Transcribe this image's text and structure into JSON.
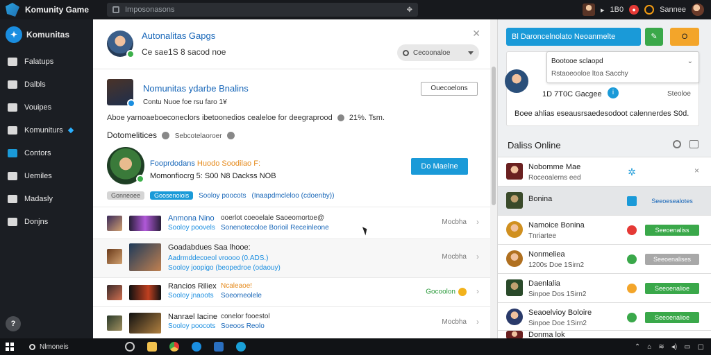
{
  "app": {
    "title": "Komunity Game"
  },
  "search": {
    "placeholder": "Imposonasons"
  },
  "topbar": {
    "counter": "1B0",
    "user": "Sannee"
  },
  "sidebar": {
    "brand": "Komunitas",
    "items": [
      {
        "label": "Falatups"
      },
      {
        "label": "Dalbls"
      },
      {
        "label": "Vouipes"
      },
      {
        "label": "Komuniturs"
      },
      {
        "label": "Contors"
      },
      {
        "label": "Uemiles"
      },
      {
        "label": "Madasly"
      },
      {
        "label": "Donjns"
      }
    ],
    "help": "?"
  },
  "main": {
    "header": {
      "title": "Autonalitas Gapgs",
      "subtitle": "Ce sae1S 8 sacod noe",
      "dropdown": "Cecoonaloe"
    },
    "group": {
      "title": "Nomunitas ydarbe Bnalins",
      "sub": "Contu Nuoe foe rsu faro 1¥",
      "button": "Ouecoelons",
      "description": "Aboe yarnoaeboeconeclors ibetoonedios cealeloe for deegraprood",
      "description_suffix": "21%. Tsm.",
      "details_label": "Dotomelitices",
      "details_small": "Sebcotelaoroer"
    },
    "featured": {
      "line1_a": "Fooprdodans",
      "line1_b": "Huodo Soodilao F:",
      "line2": "Momonfiocrg 5: S00 N8 Dackss NOB",
      "button": "Do Maelne"
    },
    "tagline": {
      "pill1": "Gonneoee",
      "pill2": "Goosenoiois",
      "text1": "Sooloy poocots",
      "text2": "(Inaapdmcleloo (cdoenby))"
    },
    "rows": [
      {
        "name": "Anmona Nino",
        "sub": "Sooloy poovels",
        "mid1": "ooerlot coeoelale Saoeomortoe@",
        "mid2": "Sonenotecoloe Borioil Receinleone",
        "status": "Mocbha"
      },
      {
        "name": "Goadabdues Saa lhooe:",
        "sub": "Aadrmddecoeol vroooo (0.ADS.)",
        "sub2": "Sooloy joopigo (beopedroe (odaouy)",
        "mid1": "",
        "mid2": "",
        "status": "Mocbha"
      },
      {
        "name": "Rancios Riliex",
        "sub": "Sooloy jnaoots",
        "mid1": "Ncaleaoe!",
        "mid2": "Soeorneolele",
        "status": "Gocoolon"
      },
      {
        "name": "Nanrael Iacine",
        "sub": "Sooloy poocots",
        "mid1": "conelor fooestol",
        "mid2": "Soeoos Reolo",
        "status": "Mocbha"
      }
    ]
  },
  "right": {
    "search_button": "Bl  Daroncelnolato  Neoanmelte",
    "orange_button": "O",
    "tooltip": {
      "title": "Bootooe sclaopd",
      "sub": "Rstaoeooloe ltoa Sacchy"
    },
    "card": {
      "line1": "1D 7T0C Gacgee",
      "right": "Steoloe",
      "line2": "Boee ahlias eseausrsaedesodoot calennerdes S0d."
    },
    "online_heading": "Daliss Online",
    "online": [
      {
        "name": "Nobomme Mae",
        "sub": "Roceoalerns eed",
        "status": "gear",
        "btn": "",
        "close": "×"
      },
      {
        "name": "Bonina",
        "sub": "",
        "status": "blue",
        "btn": "Seeoesealotes",
        "btn_style": "plain"
      },
      {
        "name": "Namoice Bonina",
        "sub": "Tnriartee",
        "status": "red",
        "btn": "Seeoenaliss",
        "btn_style": "green"
      },
      {
        "name": "Nonmeliea",
        "sub": "1200s Doe 1Sirn2",
        "status": "green",
        "btn": "Seeoenalises",
        "btn_style": "gray"
      },
      {
        "name": "Daenlalia",
        "sub": "Sinpoe Dos 1Sirn2",
        "status": "orange",
        "btn": "Seeoenalioe",
        "btn_style": "green"
      },
      {
        "name": "Seaoelvioy Boloire",
        "sub": "Sinpoe Doe 1Sirn2",
        "status": "green",
        "btn": "Seeoenalioe",
        "btn_style": "green"
      },
      {
        "name": "Donma lok",
        "sub": "",
        "status": "",
        "btn": ""
      }
    ]
  },
  "taskbar": {
    "search": "Nlmoneis"
  }
}
